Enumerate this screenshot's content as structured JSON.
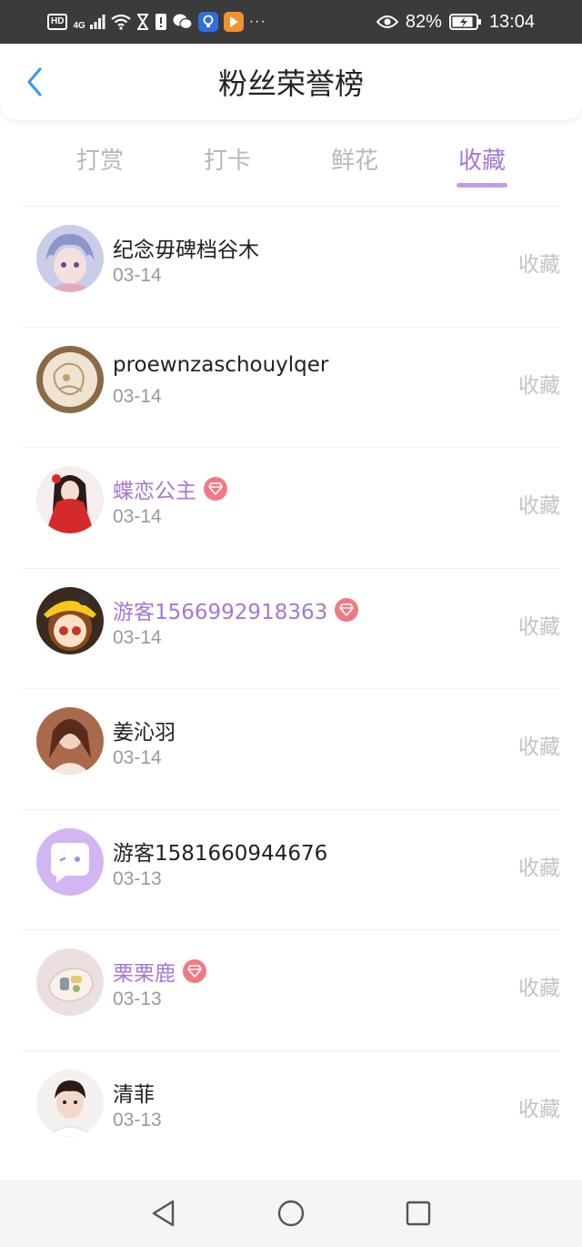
{
  "status_bar": {
    "hd_label": "HD",
    "network_label": "4G",
    "battery_percent": "82%",
    "time": "13:04",
    "more_dots": "···"
  },
  "header": {
    "title": "粉丝荣誉榜",
    "back_icon": "chevron-left-icon"
  },
  "tabs": [
    {
      "label": "打赏",
      "active": false
    },
    {
      "label": "打卡",
      "active": false
    },
    {
      "label": "鲜花",
      "active": false
    },
    {
      "label": "收藏",
      "active": true
    }
  ],
  "colors": {
    "accent": "#a777d6",
    "vip_badge": "#f07a84",
    "inactive_text": "#b8b8b8",
    "status_bar_bg": "#3b3b3b"
  },
  "fans": [
    {
      "name": "纪念毋碑档谷木",
      "date": "03-14",
      "action": "收藏",
      "vip": false
    },
    {
      "name": "proewnzaschouylqer",
      "date": "03-14",
      "action": "收藏",
      "vip": false
    },
    {
      "name": "蝶恋公主",
      "date": "03-14",
      "action": "收藏",
      "vip": true
    },
    {
      "name": "游客1566992918363",
      "date": "03-14",
      "action": "收藏",
      "vip": true
    },
    {
      "name": "姜沁羽",
      "date": "03-14",
      "action": "收藏",
      "vip": false
    },
    {
      "name": "游客1581660944676",
      "date": "03-13",
      "action": "收藏",
      "vip": false
    },
    {
      "name": "栗栗鹿",
      "date": "03-13",
      "action": "收藏",
      "vip": true
    },
    {
      "name": "清菲",
      "date": "03-13",
      "action": "收藏",
      "vip": false
    }
  ]
}
